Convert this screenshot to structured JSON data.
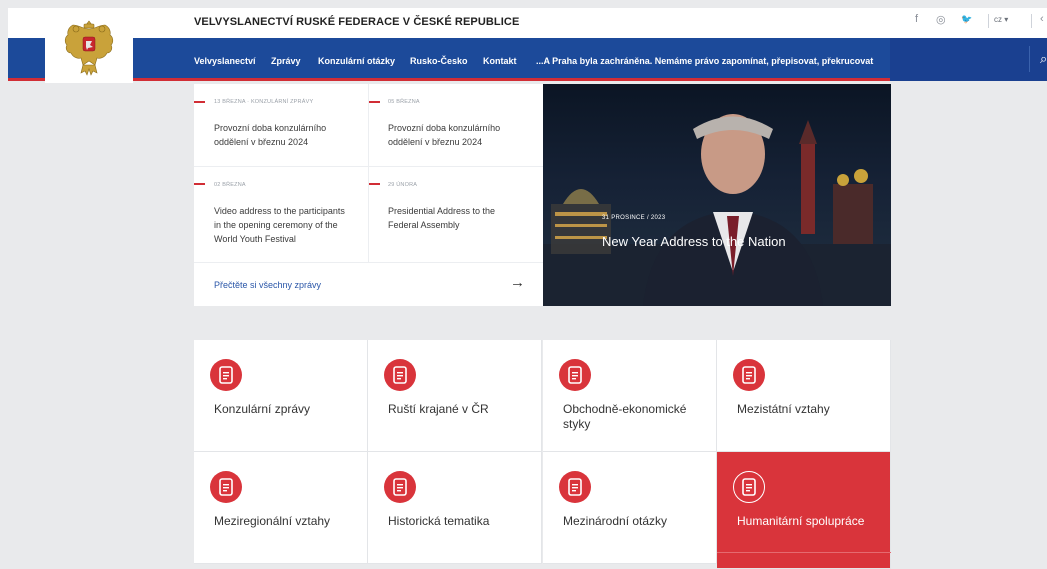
{
  "header": {
    "site_title": "VELVYSLANECTVÍ RUSKÉ FEDERACE V ČESKÉ REPUBLICE",
    "language": "cz ▾",
    "social": [
      "f",
      "◎",
      "𝕪"
    ]
  },
  "nav": {
    "items": [
      "Velvyslanectví",
      "Zprávy",
      "Konzulární otázky",
      "Rusko-Česko",
      "Kontakt",
      "...A Praha byla zachráněna. Nemáme právo zapomínat, přepisovat, překrucovat"
    ]
  },
  "news": {
    "items": [
      {
        "date": "13 BŘEZNA · KONZULÁRNÍ ZPRÁVY",
        "title": "Provozní doba konzulárního oddělení v březnu 2024"
      },
      {
        "date": "05 BŘEZNA",
        "title": "Provozní doba konzulárního oddělení v březnu 2024"
      },
      {
        "date": "02 BŘEZNA",
        "title": "Video address to the participants in the opening ceremony of the World Youth Festival"
      },
      {
        "date": "29 ÚNORA",
        "title": "Presidential Address to the Federal Assembly"
      }
    ],
    "read_all": "Přečtěte si všechny zprávy",
    "arrow": "→"
  },
  "hero": {
    "date": "31 PROSINCE / 2023",
    "title": "New Year Address to the Nation"
  },
  "categories": [
    {
      "label": "Konzulární zprávy",
      "active": false
    },
    {
      "label": "Ruští krajané v ČR",
      "active": false
    },
    {
      "label": "Obchodně-ekonomické styky",
      "active": false
    },
    {
      "label": "Mezistátní vztahy",
      "active": false
    },
    {
      "label": "Meziregionální vztahy",
      "active": false
    },
    {
      "label": "Historická tematika",
      "active": false
    },
    {
      "label": "Mezinárodní otázky",
      "active": false
    },
    {
      "label": "Humanitární spolupráce",
      "active": true
    }
  ],
  "colors": {
    "nav_blue": "#1c4a9a",
    "accent_red": "#d9343b"
  }
}
